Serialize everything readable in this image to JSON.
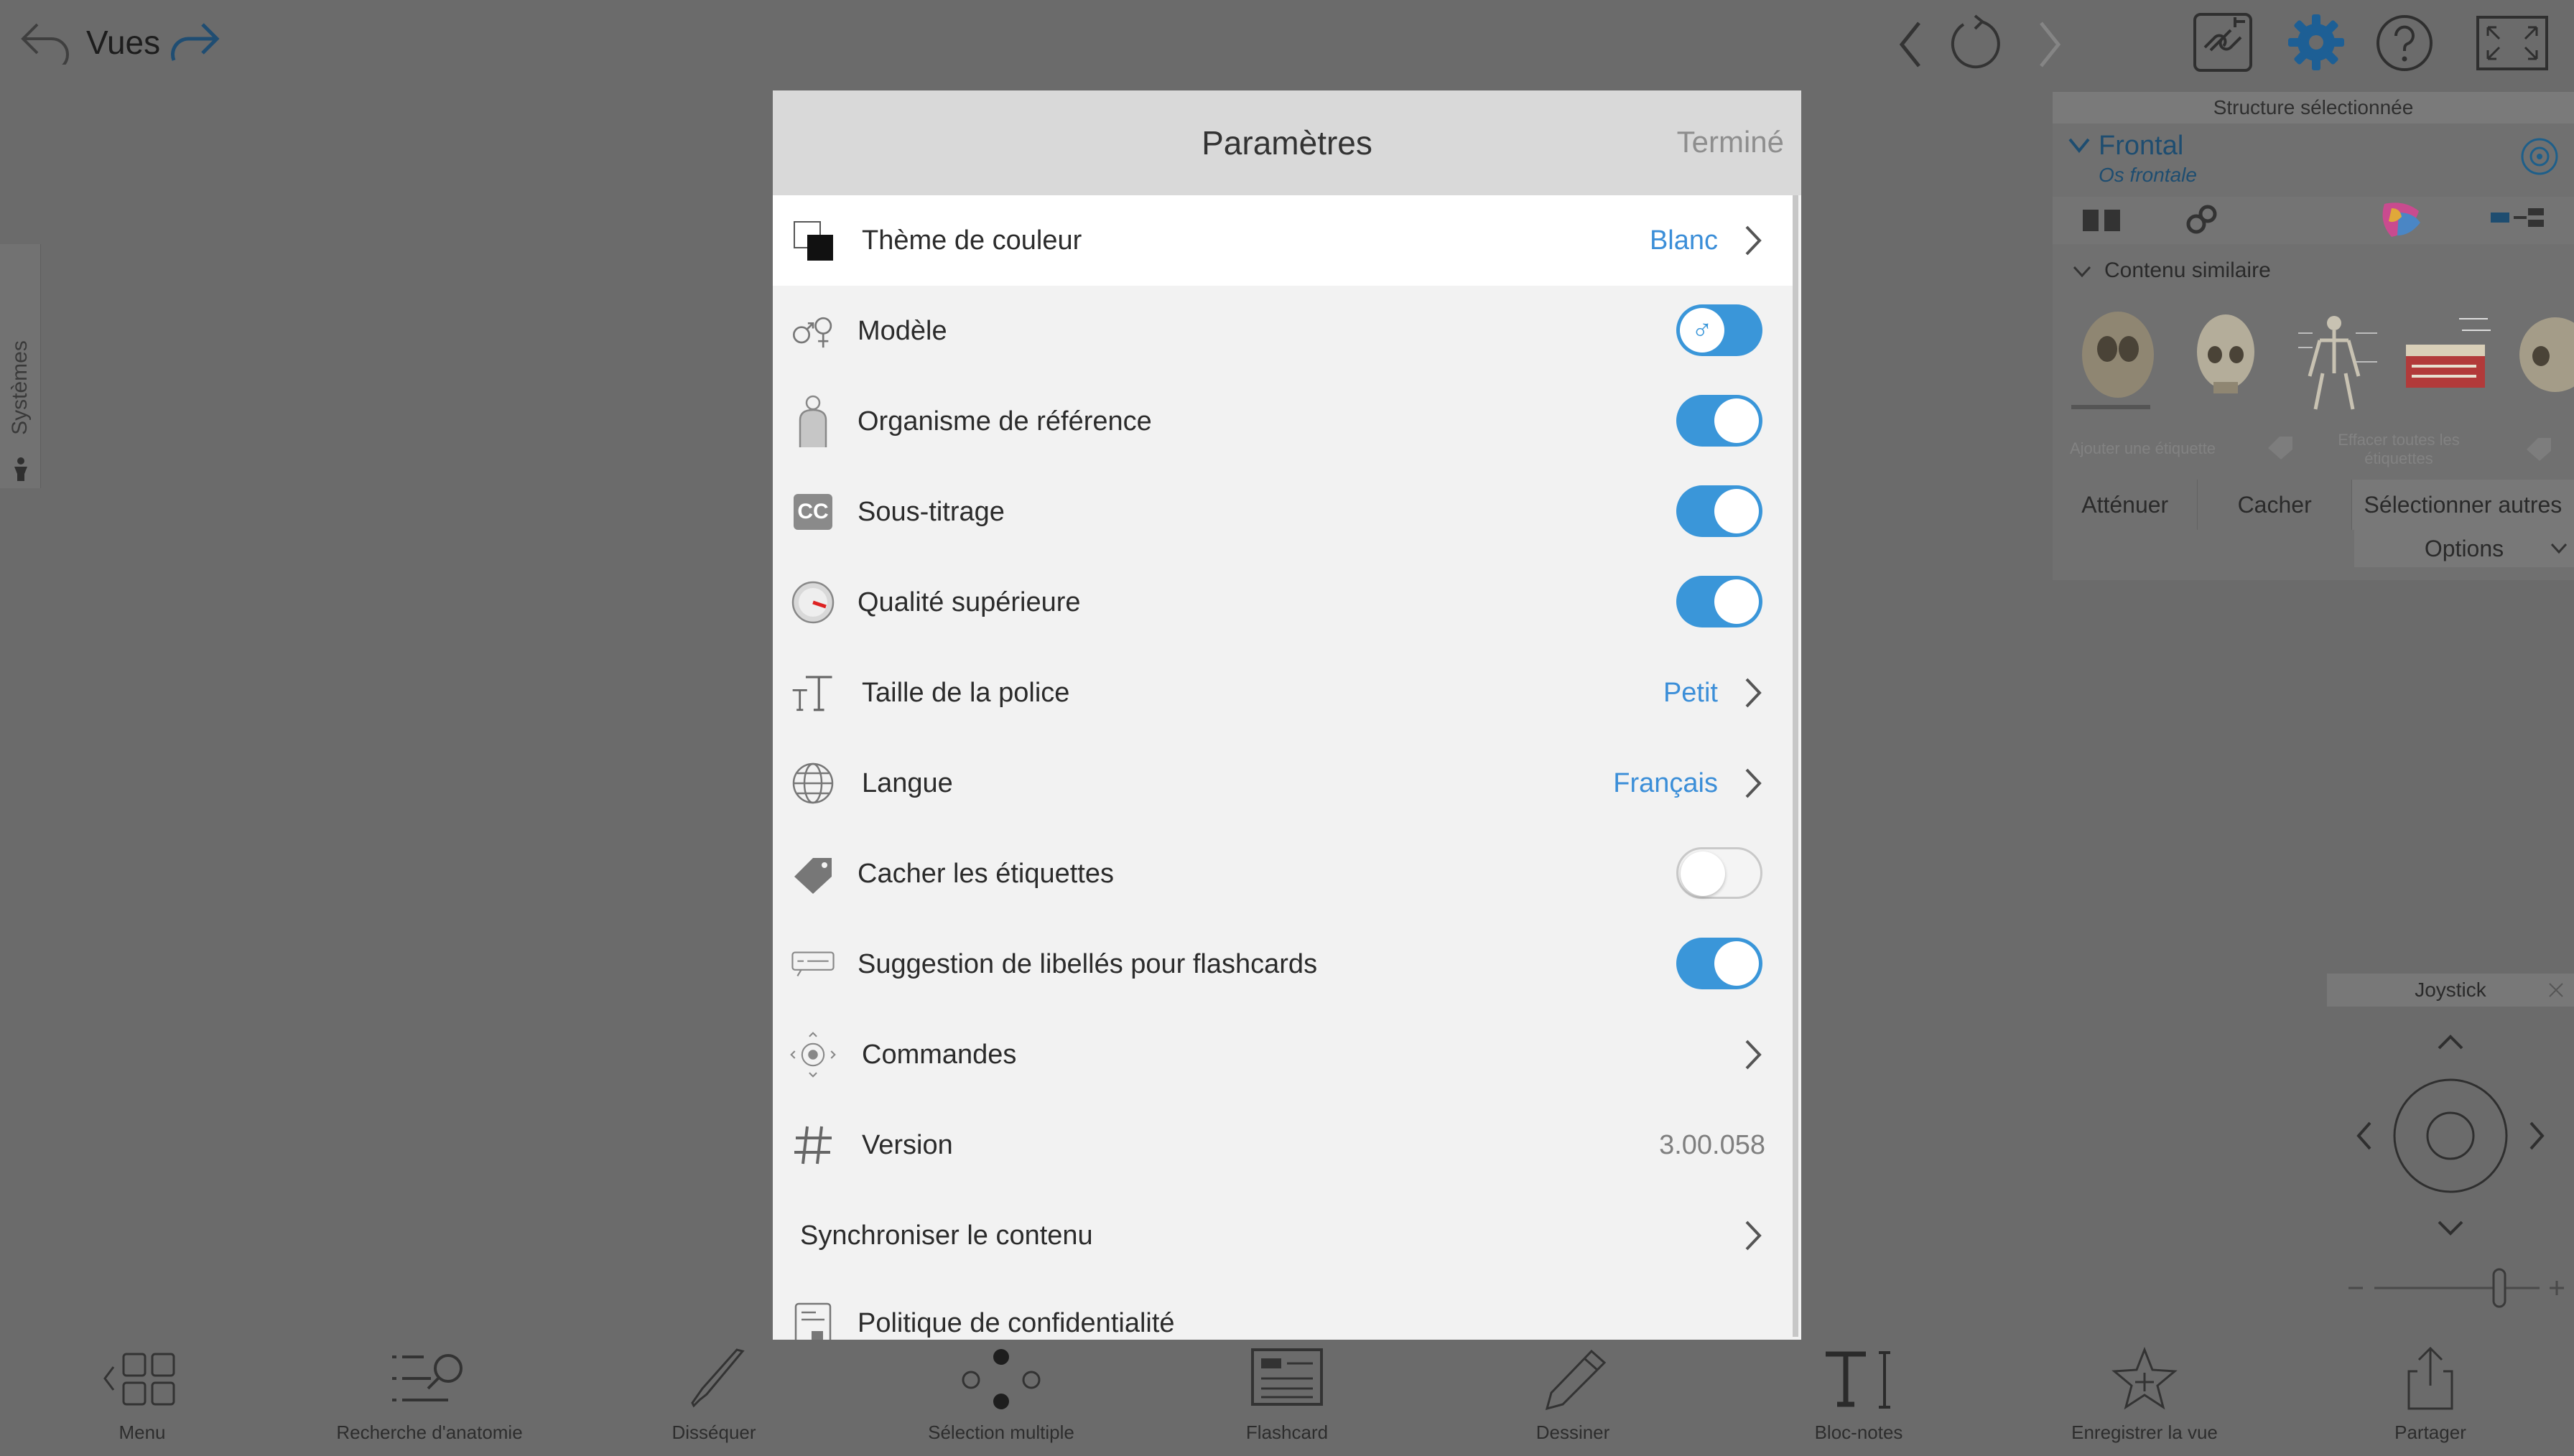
{
  "topbar": {
    "title": "Vues"
  },
  "systems_tab": {
    "label": "Systèmes"
  },
  "right_panel": {
    "header": "Structure sélectionnée",
    "structure_name": "Frontal",
    "structure_latin": "Os frontale",
    "similar_content": "Contenu similaire",
    "add_label": "Ajouter une étiquette",
    "clear_labels": "Effacer toutes les étiquettes",
    "actions": [
      "Atténuer",
      "Cacher",
      "Sélectionner autres"
    ],
    "options": "Options"
  },
  "joystick": {
    "title": "Joystick"
  },
  "modal": {
    "title": "Paramètres",
    "done": "Terminé",
    "rows": {
      "color_theme": {
        "label": "Thème de couleur",
        "value": "Blanc"
      },
      "model": {
        "label": "Modèle",
        "on": true,
        "symbol": "♂"
      },
      "reference": {
        "label": "Organisme de référence",
        "on": true
      },
      "subtitles": {
        "label": "Sous-titrage",
        "on": true,
        "badge": "CC"
      },
      "quality": {
        "label": "Qualité supérieure",
        "on": true
      },
      "font_size": {
        "label": "Taille de la police",
        "value": "Petit"
      },
      "language": {
        "label": "Langue",
        "value": "Français"
      },
      "hide_labels": {
        "label": "Cacher les étiquettes",
        "on": false
      },
      "flashcards": {
        "label": "Suggestion de libellés pour flashcards",
        "on": true
      },
      "controls": {
        "label": "Commandes"
      },
      "version": {
        "label": "Version",
        "value": "3.00.058"
      },
      "sync": {
        "label": "Synchroniser le contenu"
      },
      "privacy": {
        "label": "Politique de confidentialité"
      }
    }
  },
  "toolbar": {
    "items": [
      {
        "label": "Menu",
        "icon": "menu-grid-icon"
      },
      {
        "label": "Recherche d'anatomie",
        "icon": "anatomy-search-icon"
      },
      {
        "label": "Disséquer",
        "icon": "scalpel-icon"
      },
      {
        "label": "Sélection multiple",
        "icon": "multi-select-icon"
      },
      {
        "label": "Flashcard",
        "icon": "flashcard-icon"
      },
      {
        "label": "Dessiner",
        "icon": "pencil-icon"
      },
      {
        "label": "Bloc-notes",
        "icon": "text-icon"
      },
      {
        "label": "Enregistrer la vue",
        "icon": "star-icon"
      },
      {
        "label": "Partager",
        "icon": "share-icon"
      }
    ]
  },
  "colors": {
    "accent": "#3a96d9",
    "panel_bg": "#6b6b6b",
    "modal_header": "#d9d9d9"
  }
}
